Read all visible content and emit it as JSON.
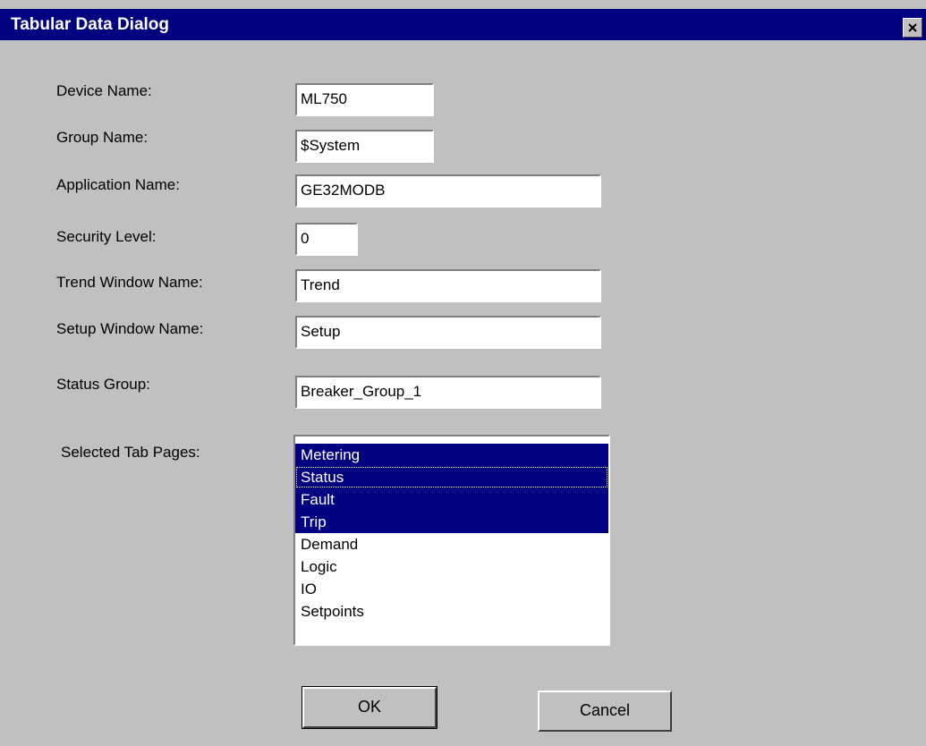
{
  "window": {
    "title": "Tabular Data Dialog"
  },
  "fields": {
    "device_name": {
      "label": "Device Name:",
      "value": "ML750"
    },
    "group_name": {
      "label": "Group Name:",
      "value": "$System"
    },
    "application_name": {
      "label": "Application Name:",
      "value": "GE32MODB"
    },
    "security_level": {
      "label": "Security Level:",
      "value": "0"
    },
    "trend_window_name": {
      "label": "Trend Window Name:",
      "value": "Trend"
    },
    "setup_window_name": {
      "label": "Setup Window Name:",
      "value": "Setup"
    },
    "status_group": {
      "label": "Status Group:",
      "value": "Breaker_Group_1"
    }
  },
  "tab_pages": {
    "label": "Selected Tab Pages:",
    "items": [
      {
        "label": "Metering",
        "selected": true
      },
      {
        "label": "Status",
        "selected": true
      },
      {
        "label": "Fault",
        "selected": true
      },
      {
        "label": "Trip",
        "selected": true
      },
      {
        "label": "Demand",
        "selected": false
      },
      {
        "label": "Logic",
        "selected": false
      },
      {
        "label": "IO",
        "selected": false
      },
      {
        "label": "Setpoints",
        "selected": false
      }
    ]
  },
  "buttons": {
    "ok": "OK",
    "cancel": "Cancel"
  },
  "colors": {
    "titlebar": "#000080",
    "face": "#c0c0c0",
    "selection": "#000080"
  },
  "icons": {
    "close": "close-icon"
  }
}
